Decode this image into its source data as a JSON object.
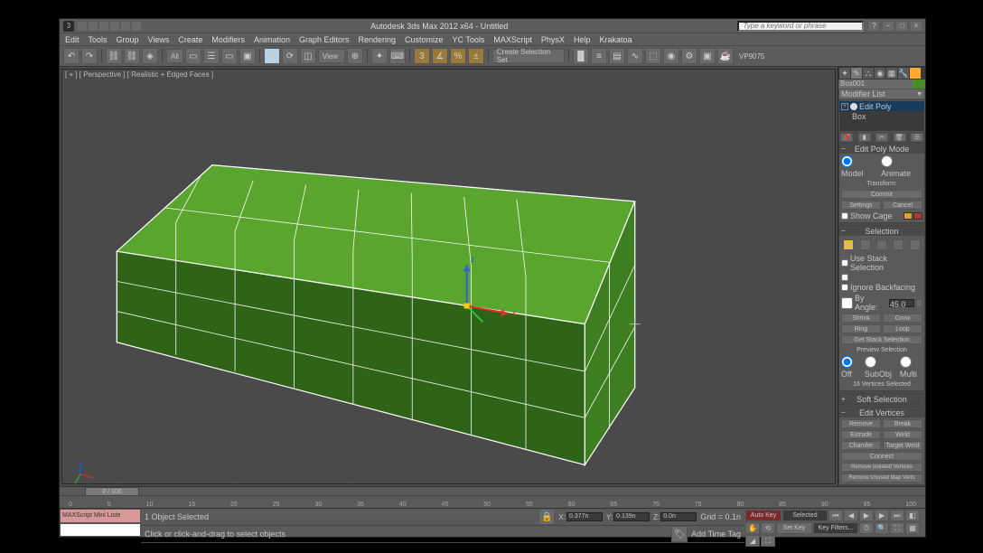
{
  "titlebar": {
    "title": "Autodesk 3ds Max 2012 x64  - Untitled",
    "search_placeholder": "Type a keyword or phrase"
  },
  "menu": [
    "Edit",
    "Tools",
    "Group",
    "Views",
    "Create",
    "Modifiers",
    "Animation",
    "Graph Editors",
    "Rendering",
    "Customize",
    "YC Tools",
    "MAXScript",
    "PhysX",
    "Help",
    "Krakatoa"
  ],
  "toolbar": {
    "filter": "All",
    "selset": "Create Selection Set",
    "vptext": "VP9075"
  },
  "viewport": {
    "label": "[ + ] [ Perspective ] [ Realistic + Edged Faces ]"
  },
  "panel": {
    "object_name": "Box001",
    "modlist_label": "Modifier List",
    "stack": [
      {
        "label": "Edit Poly",
        "selected": true,
        "expandable": true
      },
      {
        "label": "Box",
        "selected": false,
        "indent": true
      }
    ],
    "editpoly": {
      "header": "Edit Poly Mode",
      "model": "Model",
      "animate": "Animate",
      "transform": "Transform:",
      "commit": "Commit",
      "settings": "Settings",
      "cancel": "Cancel",
      "showcage": "Show Cage"
    },
    "selection": {
      "header": "Selection",
      "usestack": "Use Stack Selection",
      "ignore": "Ignore Backfacing",
      "byangle": "By Angle:",
      "angle": "45.0",
      "shrink": "Shrink",
      "grow": "Grow",
      "ring": "Ring",
      "loop": "Loop",
      "getstack": "Get Stack Selection",
      "preview": "Preview Selection",
      "off": "Off",
      "subobj": "SubObj",
      "multi": "Multi",
      "status": "16 Vertices Selected"
    },
    "softsel": {
      "header": "Soft Selection"
    },
    "editverts": {
      "header": "Edit Vertices",
      "remove": "Remove",
      "break": "Break",
      "extrude": "Extrude",
      "weld": "Weld",
      "chamfer": "Chamfer",
      "target": "Target Weld",
      "connect": "Connect",
      "removeiso": "Remove Isolated Vertices",
      "removeunused": "Remove Unused Map Verts"
    }
  },
  "trackbar": {
    "slider": "0 / 100"
  },
  "timeruler": [
    "0",
    "5",
    "10",
    "15",
    "20",
    "25",
    "30",
    "35",
    "40",
    "45",
    "50",
    "55",
    "60",
    "65",
    "70",
    "75",
    "80",
    "85",
    "90",
    "95",
    "100"
  ],
  "status": {
    "listener": "MAXScript Mini Liste",
    "sel": "1 Object Selected",
    "prompt": "Click or click-and-drag to select objects",
    "x": "0.377n",
    "y": "0.139n",
    "z": "0.0n",
    "grid": "Grid = 0.1n",
    "addtime": "Add Time Tag",
    "autokey": "Auto Key",
    "selected": "Selected",
    "setkey": "Set Key",
    "keyfilt": "Key Filters..."
  }
}
